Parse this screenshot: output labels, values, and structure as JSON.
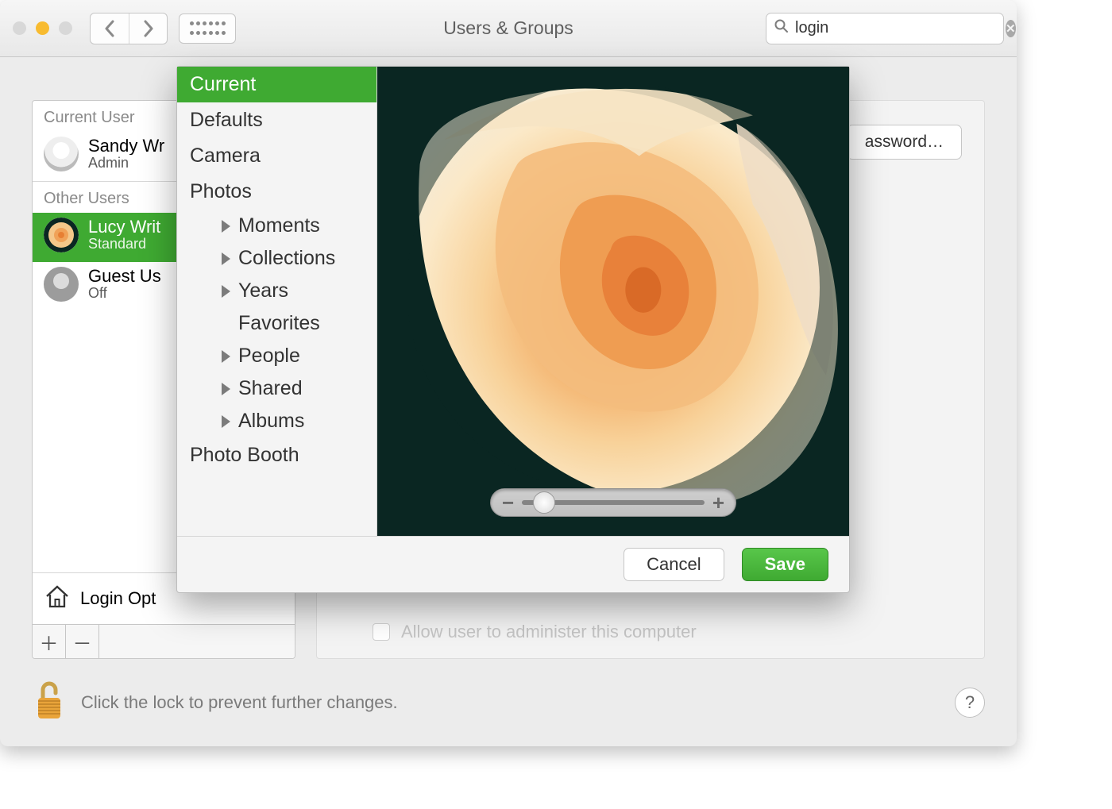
{
  "titlebar": {
    "title": "Users & Groups",
    "search_value": "login"
  },
  "sidebar": {
    "current_user_label": "Current User",
    "other_users_label": "Other Users",
    "login_options_label": "Login Opt",
    "users": [
      {
        "name": "Sandy Wr",
        "role": "Admin"
      },
      {
        "name": "Lucy Writ",
        "role": "Standard"
      },
      {
        "name": "Guest Us",
        "role": "Off"
      }
    ]
  },
  "right": {
    "password_button": "assword…",
    "admin_checkbox_label": "Allow user to administer this computer"
  },
  "footer": {
    "lock_text": "Click the lock to prevent further changes."
  },
  "popover": {
    "sources": {
      "current": "Current",
      "defaults": "Defaults",
      "camera": "Camera",
      "photos": "Photos",
      "moments": "Moments",
      "collections": "Collections",
      "years": "Years",
      "favorites": "Favorites",
      "people": "People",
      "shared": "Shared",
      "albums": "Albums",
      "photobooth": "Photo Booth"
    },
    "cancel": "Cancel",
    "save": "Save"
  }
}
